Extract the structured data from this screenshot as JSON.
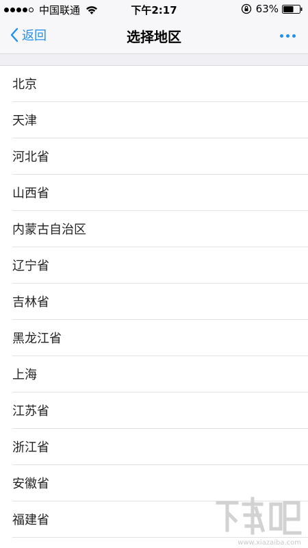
{
  "status_bar": {
    "carrier": "中国联通",
    "time": "下午2:17",
    "battery_percent": "63%",
    "signal_bars_filled": 4,
    "signal_bars_total": 5,
    "battery_level": 0.63
  },
  "nav": {
    "back_label": "返回",
    "title": "选择地区",
    "accent_color": "#1f8ff0"
  },
  "regions": [
    "北京",
    "天津",
    "河北省",
    "山西省",
    "内蒙古自治区",
    "辽宁省",
    "吉林省",
    "黑龙江省",
    "上海",
    "江苏省",
    "浙江省",
    "安徽省",
    "福建省"
  ],
  "watermark": {
    "url": "www.xiazaiba.com",
    "logo": "下载吧"
  }
}
